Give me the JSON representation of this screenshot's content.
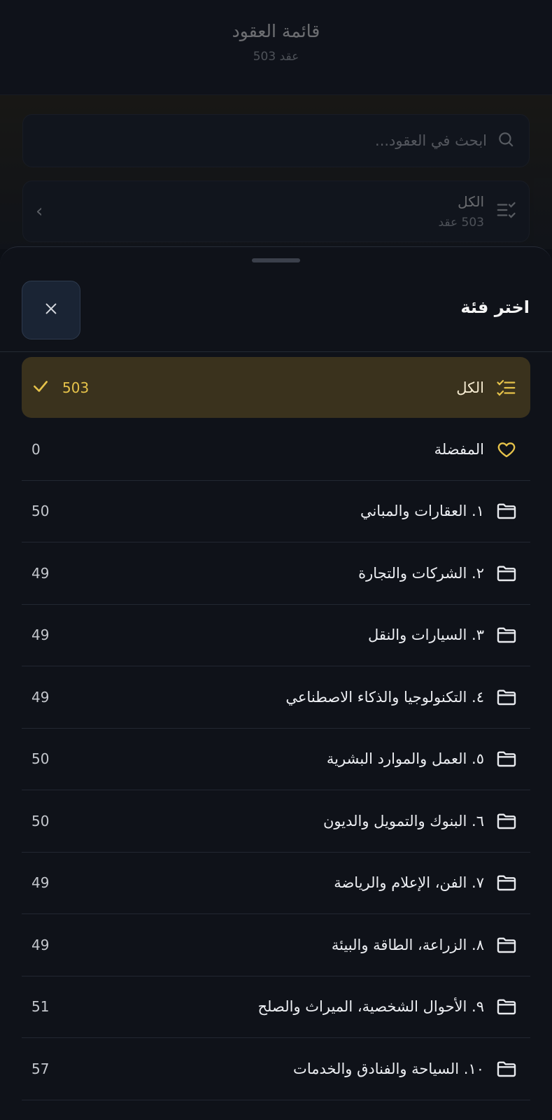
{
  "background": {
    "title": "قائمة العقود",
    "subtitle": "503 عقد",
    "search_placeholder": "ابحث في العقود...",
    "filter_title": "الكل",
    "filter_subtitle": "503 عقد"
  },
  "sheet": {
    "title": "اختر فئة",
    "items": [
      {
        "label": "الكل",
        "count": "503",
        "icon": "checklist-icon",
        "selected": true
      },
      {
        "label": "المفضلة",
        "count": "0",
        "icon": "heart-icon"
      },
      {
        "label": "١. العقارات والمباني",
        "count": "50",
        "icon": "folder-icon"
      },
      {
        "label": "٢. الشركات والتجارة",
        "count": "49",
        "icon": "folder-icon"
      },
      {
        "label": "٣. السيارات والنقل",
        "count": "49",
        "icon": "folder-icon"
      },
      {
        "label": "٤. التكنولوجيا والذكاء الاصطناعي",
        "count": "49",
        "icon": "folder-icon"
      },
      {
        "label": "٥. العمل والموارد البشرية",
        "count": "50",
        "icon": "folder-icon"
      },
      {
        "label": "٦. البنوك والتمويل والديون",
        "count": "50",
        "icon": "folder-icon"
      },
      {
        "label": "٧. الفن، الإعلام والرياضة",
        "count": "49",
        "icon": "folder-icon"
      },
      {
        "label": "٨. الزراعة، الطاقة والبيئة",
        "count": "49",
        "icon": "folder-icon"
      },
      {
        "label": "٩. الأحوال الشخصية، الميراث والصلح",
        "count": "51",
        "icon": "folder-icon"
      },
      {
        "label": "١٠. السياحة والفنادق والخدمات",
        "count": "57",
        "icon": "folder-icon"
      }
    ]
  },
  "colors": {
    "accent": "#e6c34a",
    "selected_bg": "#3a321d",
    "sheet_bg": "#10131a"
  }
}
